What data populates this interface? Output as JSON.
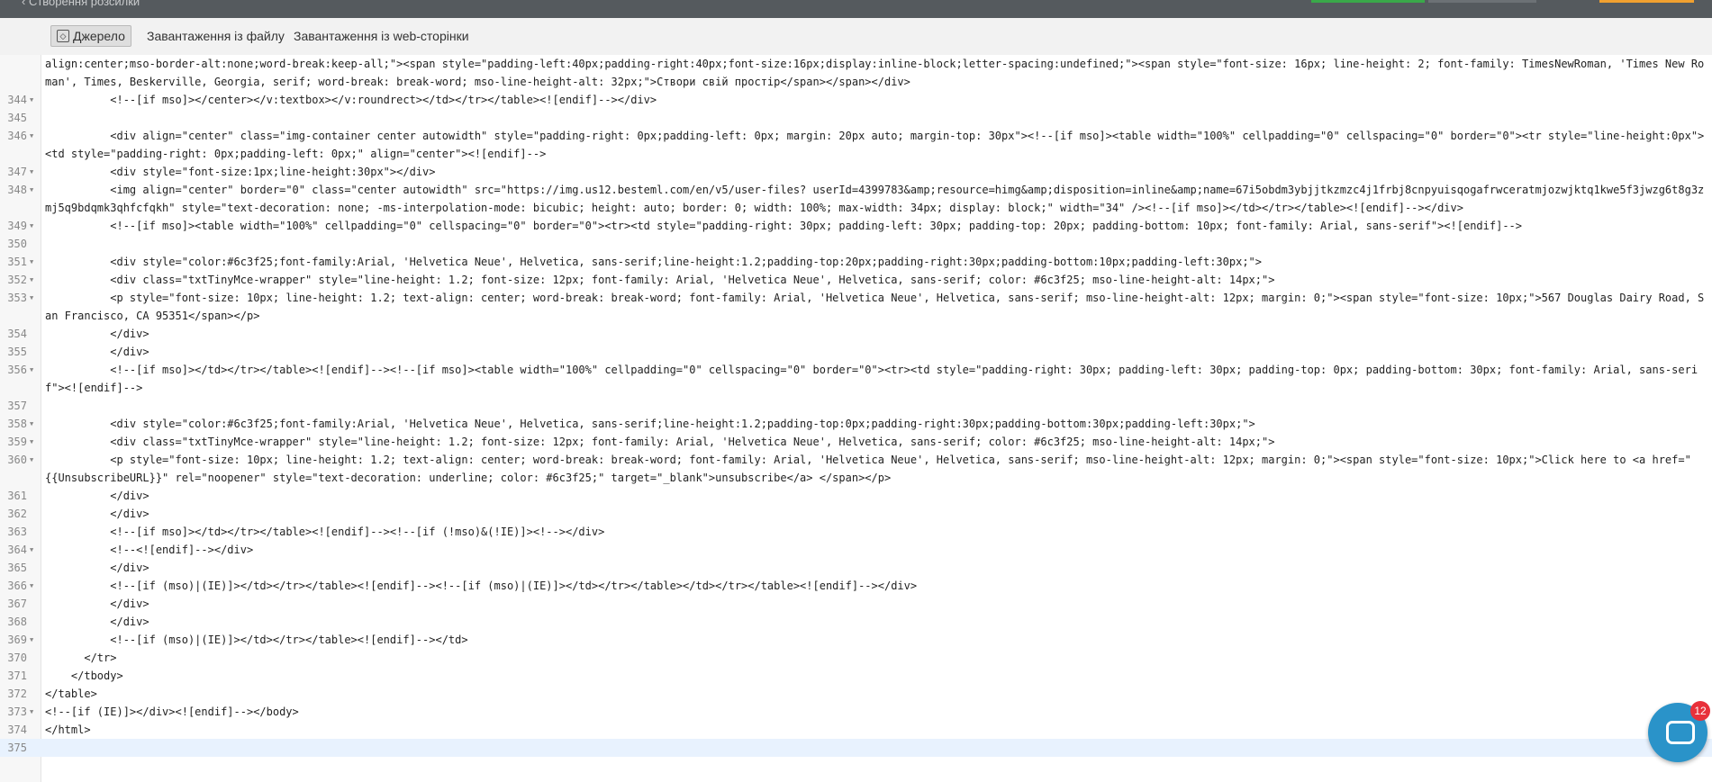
{
  "topbar": {
    "back_label": "Створення розсилки"
  },
  "toolbar": {
    "source_label": "Джерело",
    "upload_file_label": "Завантаження із файлу",
    "upload_web_label": "Завантаження із web-сторінки"
  },
  "code_lines": [
    {
      "num": "",
      "fold": false,
      "text": "align:center;mso-border-alt:none;word-break:keep-all;\"><span style=\"padding-left:40px;padding-right:40px;font-size:16px;display:inline-block;letter-spacing:undefined;\"><span style=\"font-size: 16px; line-height: 2; font-family: TimesNewRoman, 'Times New Roman', Times, Beskerville, Georgia, serif; word-break: break-word; mso-line-height-alt: 32px;\">Створи свій простір</span></span></div>"
    },
    {
      "num": "344",
      "fold": true,
      "text": "          <!--[if mso]></center></v:textbox></v:roundrect></td></tr></table><![endif]--></div>"
    },
    {
      "num": "345",
      "fold": false,
      "text": ""
    },
    {
      "num": "346",
      "fold": true,
      "text": "          <div align=\"center\" class=\"img-container center autowidth\" style=\"padding-right: 0px;padding-left: 0px; margin: 20px auto; margin-top: 30px\"><!--[if mso]><table width=\"100%\" cellpadding=\"0\" cellspacing=\"0\" border=\"0\"><tr style=\"line-height:0px\"><td style=\"padding-right: 0px;padding-left: 0px;\" align=\"center\"><![endif]-->"
    },
    {
      "num": "347",
      "fold": true,
      "text": "          <div style=\"font-size:1px;line-height:30px\"></div>"
    },
    {
      "num": "348",
      "fold": true,
      "text": "          <img align=\"center\" border=\"0\" class=\"center autowidth\" src=\"https://img.us12.besteml.com/en/v5/user-files? userId=4399783&amp;resource=himg&amp;disposition=inline&amp;name=67i5obdm3ybjjtkzmzc4j1frbj8cnpyuisqogafrwceratmjozwjktq1kwe5f3jwzg6t8g3zmj5q9bdqmk3qhfcfqkh\" style=\"text-decoration: none; -ms-interpolation-mode: bicubic; height: auto; border: 0; width: 100%; max-width: 34px; display: block;\" width=\"34\" /><!--[if mso]></td></tr></table><![endif]--></div>"
    },
    {
      "num": "349",
      "fold": true,
      "text": "          <!--[if mso]><table width=\"100%\" cellpadding=\"0\" cellspacing=\"0\" border=\"0\"><tr><td style=\"padding-right: 30px; padding-left: 30px; padding-top: 20px; padding-bottom: 10px; font-family: Arial, sans-serif\"><![endif]-->"
    },
    {
      "num": "350",
      "fold": false,
      "text": ""
    },
    {
      "num": "351",
      "fold": true,
      "text": "          <div style=\"color:#6c3f25;font-family:Arial, 'Helvetica Neue', Helvetica, sans-serif;line-height:1.2;padding-top:20px;padding-right:30px;padding-bottom:10px;padding-left:30px;\">"
    },
    {
      "num": "352",
      "fold": true,
      "text": "          <div class=\"txtTinyMce-wrapper\" style=\"line-height: 1.2; font-size: 12px; font-family: Arial, 'Helvetica Neue', Helvetica, sans-serif; color: #6c3f25; mso-line-height-alt: 14px;\">"
    },
    {
      "num": "353",
      "fold": true,
      "text": "          <p style=\"font-size: 10px; line-height: 1.2; text-align: center; word-break: break-word; font-family: Arial, 'Helvetica Neue', Helvetica, sans-serif; mso-line-height-alt: 12px; margin: 0;\"><span style=\"font-size: 10px;\">567 Douglas Dairy Road, San Francisco, CA 95351</span></p>"
    },
    {
      "num": "354",
      "fold": false,
      "text": "          </div>"
    },
    {
      "num": "355",
      "fold": false,
      "text": "          </div>"
    },
    {
      "num": "356",
      "fold": true,
      "text": "          <!--[if mso]></td></tr></table><![endif]--><!--[if mso]><table width=\"100%\" cellpadding=\"0\" cellspacing=\"0\" border=\"0\"><tr><td style=\"padding-right: 30px; padding-left: 30px; padding-top: 0px; padding-bottom: 30px; font-family: Arial, sans-serif\"><![endif]-->"
    },
    {
      "num": "357",
      "fold": false,
      "text": ""
    },
    {
      "num": "358",
      "fold": true,
      "text": "          <div style=\"color:#6c3f25;font-family:Arial, 'Helvetica Neue', Helvetica, sans-serif;line-height:1.2;padding-top:0px;padding-right:30px;padding-bottom:30px;padding-left:30px;\">"
    },
    {
      "num": "359",
      "fold": true,
      "text": "          <div class=\"txtTinyMce-wrapper\" style=\"line-height: 1.2; font-size: 12px; font-family: Arial, 'Helvetica Neue', Helvetica, sans-serif; color: #6c3f25; mso-line-height-alt: 14px;\">"
    },
    {
      "num": "360",
      "fold": true,
      "text": "          <p style=\"font-size: 10px; line-height: 1.2; text-align: center; word-break: break-word; font-family: Arial, 'Helvetica Neue', Helvetica, sans-serif; mso-line-height-alt: 12px; margin: 0;\"><span style=\"font-size: 10px;\">Click here to <a href=\"{{UnsubscribeURL}}\" rel=\"noopener\" style=\"text-decoration: underline; color: #6c3f25;\" target=\"_blank\">unsubscribe</a> </span></p>"
    },
    {
      "num": "361",
      "fold": false,
      "text": "          </div>"
    },
    {
      "num": "362",
      "fold": false,
      "text": "          </div>"
    },
    {
      "num": "363",
      "fold": false,
      "text": "          <!--[if mso]></td></tr></table><![endif]--><!--[if (!mso)&(!IE)]><!--></div>"
    },
    {
      "num": "364",
      "fold": true,
      "text": "          <!--<![endif]--></div>"
    },
    {
      "num": "365",
      "fold": false,
      "text": "          </div>"
    },
    {
      "num": "366",
      "fold": true,
      "text": "          <!--[if (mso)|(IE)]></td></tr></table><![endif]--><!--[if (mso)|(IE)]></td></tr></table></td></tr></table><![endif]--></div>"
    },
    {
      "num": "367",
      "fold": false,
      "text": "          </div>"
    },
    {
      "num": "368",
      "fold": false,
      "text": "          </div>"
    },
    {
      "num": "369",
      "fold": true,
      "text": "          <!--[if (mso)|(IE)]></td></tr></table><![endif]--></td>"
    },
    {
      "num": "370",
      "fold": false,
      "text": "      </tr>"
    },
    {
      "num": "371",
      "fold": false,
      "text": "    </tbody>"
    },
    {
      "num": "372",
      "fold": false,
      "text": "</table>"
    },
    {
      "num": "373",
      "fold": true,
      "text": "<!--[if (IE)]></div><![endif]--></body>"
    },
    {
      "num": "374",
      "fold": false,
      "text": "</html>"
    },
    {
      "num": "375",
      "fold": false,
      "text": "",
      "current": true
    }
  ],
  "chat_widget": {
    "badge_count": "12"
  },
  "colors": {
    "topbar": "#555a5e",
    "toolbar": "#f2f2f2",
    "current_line": "#e8f2fe",
    "chat": "#2a93c9",
    "badge": "#e8313a"
  }
}
